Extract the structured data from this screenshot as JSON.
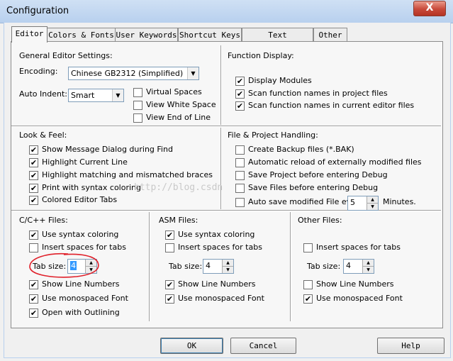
{
  "window": {
    "title": "Configuration",
    "close_glyph": "X"
  },
  "tabs": [
    "Editor",
    "Colors & Fonts",
    "User Keywords",
    "Shortcut Keys",
    "Text Completion",
    "Other"
  ],
  "general": {
    "heading": "General Editor Settings:",
    "encoding_label": "Encoding:",
    "encoding_value": "Chinese GB2312 (Simplified)",
    "indent_label": "Auto Indent:",
    "indent_value": "Smart",
    "checks": [
      {
        "label": "Virtual Spaces",
        "checked": false
      },
      {
        "label": "View White Space",
        "checked": false
      },
      {
        "label": "View End of Line",
        "checked": false
      }
    ]
  },
  "function_display": {
    "heading": "Function Display:",
    "checks": [
      {
        "label": "Display Modules",
        "checked": true
      },
      {
        "label": "Scan function names in project files",
        "checked": true
      },
      {
        "label": "Scan function names in current editor files",
        "checked": true
      }
    ]
  },
  "look_feel": {
    "heading": "Look & Feel:",
    "checks": [
      {
        "label": "Show Message Dialog during Find",
        "checked": true
      },
      {
        "label": "Highlight Current Line",
        "checked": true
      },
      {
        "label": "Highlight matching and mismatched braces",
        "checked": true
      },
      {
        "label": "Print with syntax coloring",
        "checked": true
      },
      {
        "label": "Colored Editor Tabs",
        "checked": true
      }
    ]
  },
  "file_project": {
    "heading": "File & Project Handling:",
    "checks": [
      {
        "label": "Create Backup files (*.BAK)",
        "checked": false
      },
      {
        "label": "Automatic reload of externally modified files",
        "checked": false
      },
      {
        "label": "Save Project before entering Debug",
        "checked": false
      },
      {
        "label": "Save Files before entering Debug",
        "checked": false
      },
      {
        "label": "Auto save modified File every",
        "checked": false
      }
    ],
    "autosave_value": "5",
    "minutes_label": "Minutes."
  },
  "cpp_files": {
    "heading": "C/C++ Files:",
    "syntax": {
      "label": "Use syntax coloring",
      "checked": true
    },
    "spaces": {
      "label": "Insert spaces for tabs",
      "checked": false
    },
    "tab_label": "Tab size:",
    "tab_value": "4",
    "lines": {
      "label": "Show Line Numbers",
      "checked": true
    },
    "mono": {
      "label": "Use monospaced Font",
      "checked": true
    },
    "outline": {
      "label": "Open with Outlining",
      "checked": true
    }
  },
  "asm_files": {
    "heading": "ASM Files:",
    "syntax": {
      "label": "Use syntax coloring",
      "checked": true
    },
    "spaces": {
      "label": "Insert spaces for tabs",
      "checked": false
    },
    "tab_label": "Tab size:",
    "tab_value": "4",
    "lines": {
      "label": "Show Line Numbers",
      "checked": true
    },
    "mono": {
      "label": "Use monospaced Font",
      "checked": true
    }
  },
  "other_files": {
    "heading": "Other Files:",
    "spaces": {
      "label": "Insert spaces for tabs",
      "checked": false
    },
    "tab_label": "Tab size:",
    "tab_value": "4",
    "lines": {
      "label": "Show Line Numbers",
      "checked": false
    },
    "mono": {
      "label": "Use monospaced Font",
      "checked": true
    }
  },
  "buttons": {
    "ok": "OK",
    "cancel": "Cancel",
    "help": "Help"
  },
  "watermark": "http://blog.csdn",
  "annotation_color": "#e0202a",
  "check_glyph": "✔",
  "arrow_up": "▲",
  "arrow_down": "▼"
}
